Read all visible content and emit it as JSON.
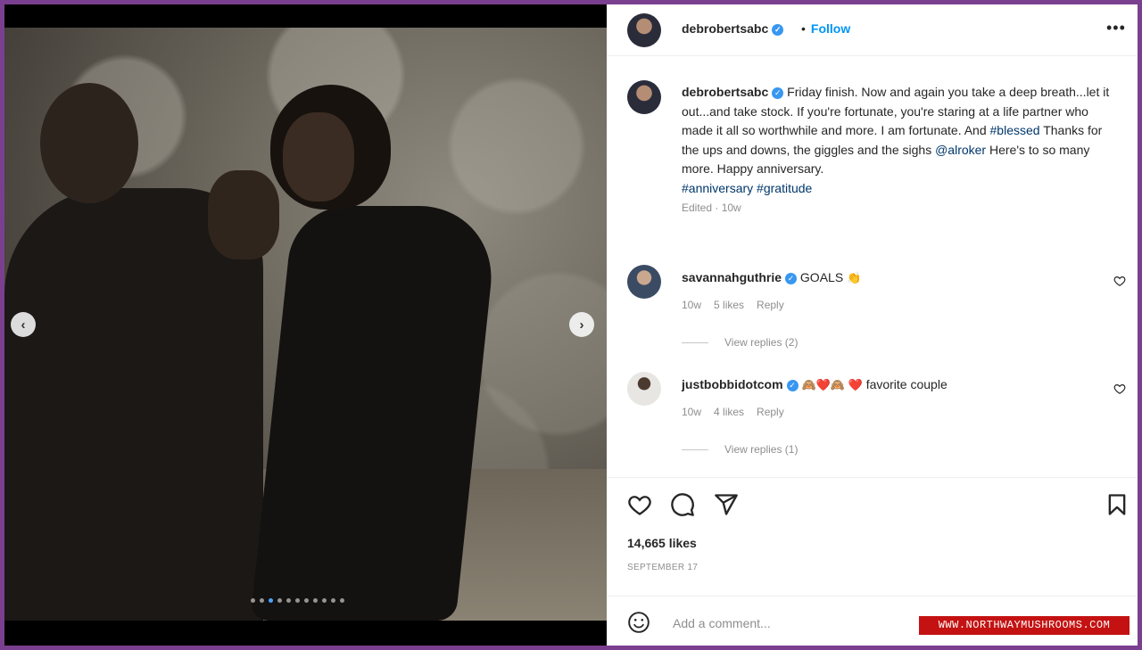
{
  "post": {
    "username": "debrobertsabc",
    "bullet": "•",
    "follow_label": "Follow",
    "more_label": "•••",
    "image_count": 11,
    "active_image_index": 3,
    "caption": {
      "username": "debrobertsabc",
      "part1": " Friday finish. Now and again you take a deep breath...let it out...and take stock. If you're fortunate, you're staring at a life partner who made it all so worthwhile and more. I am fortunate. And ",
      "hashtag_blessed": "#blessed",
      "part2": " Thanks for the ups and downs, the giggles and the sighs ",
      "mention": "@alroker",
      "part3": " Here's to so many more. Happy anniversary.",
      "hashtag_anniversary": "#anniversary",
      "hashtag_gratitude": "#gratitude",
      "edited": "Edited · 10w"
    }
  },
  "comments": [
    {
      "username": "savannahguthrie",
      "text": "GOALS",
      "emoji": "👏",
      "time": "10w",
      "likes": "5 likes",
      "reply_label": "Reply",
      "view_replies": "View replies (2)"
    },
    {
      "username": "justbobbidotcom",
      "emoji": "🙈❤️🙈 ❤️",
      "text": "favorite couple",
      "time": "10w",
      "likes": "4 likes",
      "reply_label": "Reply",
      "view_replies": "View replies (1)"
    }
  ],
  "engagement": {
    "likes": "14,665 likes",
    "date": "SEPTEMBER 17"
  },
  "composer": {
    "placeholder": "Add a comment..."
  },
  "watermark": "WWW.NORTHWAYMUSHROOMS.COM",
  "colors": {
    "border": "#7b3f8f",
    "link": "#00376b",
    "follow": "#0095f6",
    "verified": "#3897f0",
    "watermark_bg": "#c41212"
  },
  "icons": [
    "verified-badge-icon",
    "heart-icon",
    "comment-icon",
    "share-icon",
    "bookmark-icon",
    "emoji-icon",
    "chevron-left-icon",
    "chevron-right-icon"
  ]
}
